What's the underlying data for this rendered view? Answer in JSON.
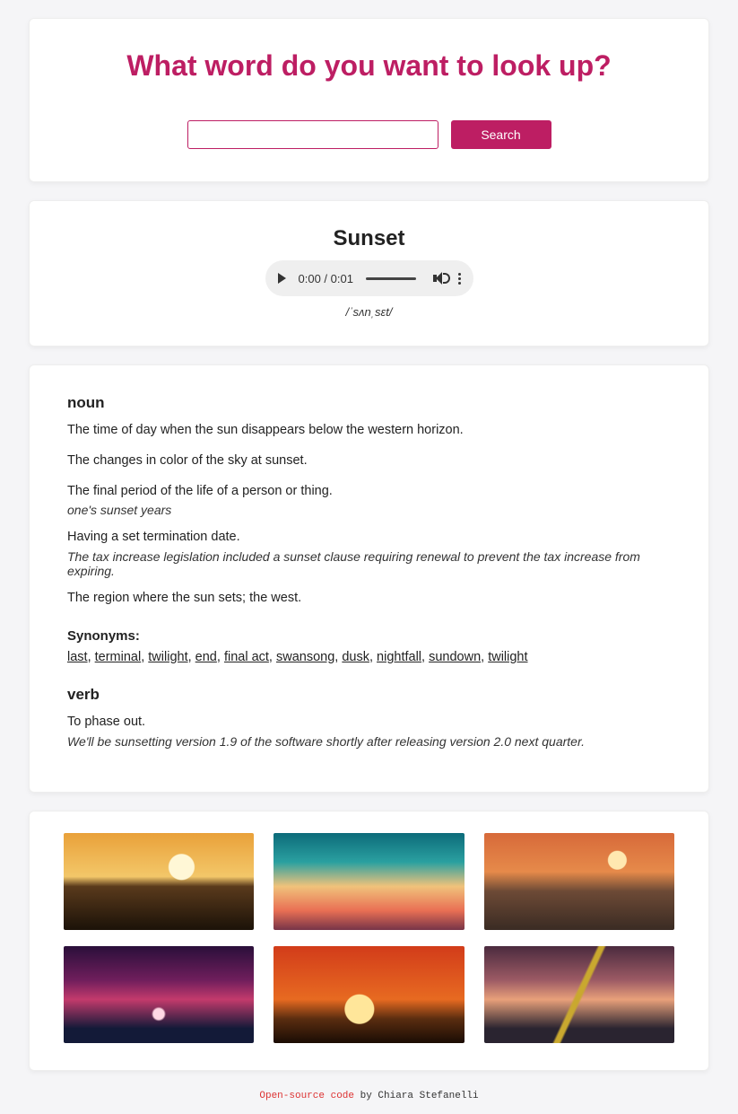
{
  "hero": {
    "title": "What word do you want to look up?",
    "search_value": "",
    "search_button": "Search"
  },
  "result": {
    "word": "Sunset",
    "audio_time": "0:00 / 0:01",
    "phonetic": "/ˈsʌnˌsɛt/"
  },
  "definitions": {
    "noun": {
      "label": "noun",
      "items": [
        {
          "text": "The time of day when the sun disappears below the western horizon.",
          "example": ""
        },
        {
          "text": "The changes in color of the sky at sunset.",
          "example": ""
        },
        {
          "text": "The final period of the life of a person or thing.",
          "example": "one's sunset years"
        },
        {
          "text": "Having a set termination date.",
          "example": "The tax increase legislation included a sunset clause requiring renewal to prevent the tax increase from expiring."
        },
        {
          "text": "The region where the sun sets; the west.",
          "example": ""
        }
      ],
      "synonyms_label": "Synonyms:",
      "synonyms": [
        "last",
        "terminal",
        "twilight",
        "end",
        "final act",
        "swansong",
        "dusk",
        "nightfall",
        "sundown",
        "twilight"
      ]
    },
    "verb": {
      "label": "verb",
      "items": [
        {
          "text": "To phase out.",
          "example": "We'll be sunsetting version 1.9 of the software shortly after releasing version 2.0 next quarter."
        }
      ]
    }
  },
  "images": {
    "items": [
      {
        "name": "sunset-silhouette-couple"
      },
      {
        "name": "sunset-gradient-teal-orange"
      },
      {
        "name": "sunset-over-ocean"
      },
      {
        "name": "sunset-pink-clouds-tree"
      },
      {
        "name": "sunset-orange-sun-tree"
      },
      {
        "name": "sunset-palm-road"
      }
    ]
  },
  "footer": {
    "link_text": "Open-source code",
    "author_prefix": " by ",
    "author": "Chiara Stefanelli"
  }
}
